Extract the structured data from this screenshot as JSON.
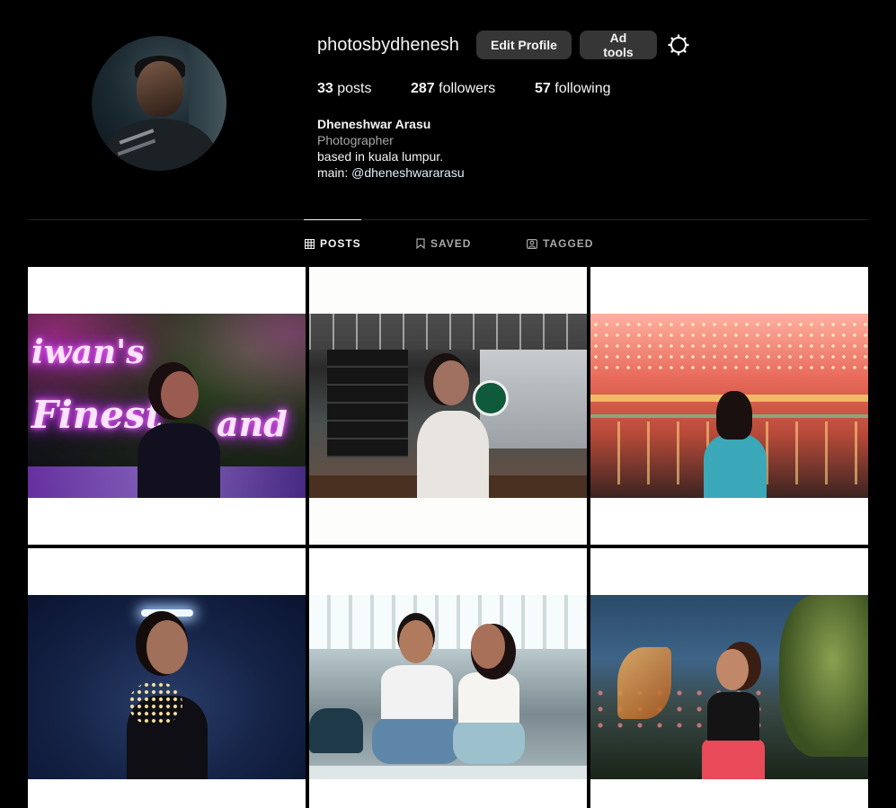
{
  "profile": {
    "username": "photosbydhenesh",
    "edit_button": "Edit Profile",
    "ad_button": "Ad tools",
    "settings_icon": "gear-icon",
    "stats": {
      "posts_count": "33",
      "posts_label": "posts",
      "followers_count": "287",
      "followers_label": "followers",
      "following_count": "57",
      "following_label": "following"
    },
    "bio": {
      "name": "Dheneshwar Arasu",
      "category": "Photographer",
      "line": "based in kuala lumpur.",
      "main_prefix": "main: ",
      "main_handle": "@dheneshwararasu"
    }
  },
  "tabs": [
    {
      "label": "POSTS",
      "icon": "grid-icon",
      "active": true
    },
    {
      "label": "SAVED",
      "icon": "bookmark-icon",
      "active": false
    },
    {
      "label": "TAGGED",
      "icon": "tag-user-icon",
      "active": false
    }
  ],
  "colors": {
    "background": "#000000",
    "button_bg": "#363636",
    "text_primary": "#f5f5f5",
    "text_secondary": "#a8a8a8",
    "link": "#e0f1ff",
    "divider": "#262626"
  }
}
